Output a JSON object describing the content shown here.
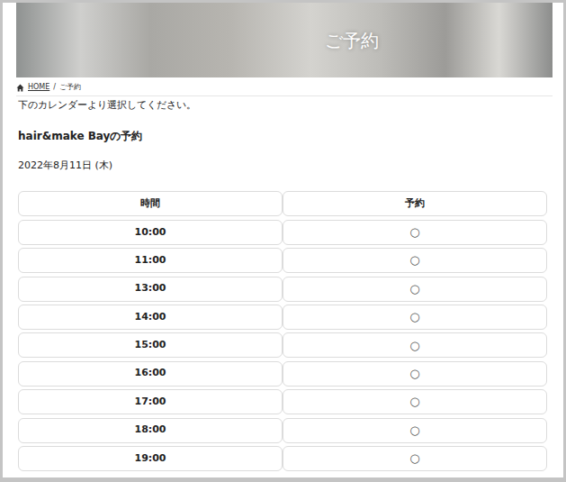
{
  "page_title": "ご予約",
  "breadcrumb": {
    "items": [
      "HOME",
      "ご予約"
    ],
    "separator": "/"
  },
  "intro": "下のカレンダーより選択してください。",
  "heading": "hair&make Bayの予約",
  "date": "2022年8月11日 (木)",
  "table": {
    "columns": [
      "時間",
      "予約"
    ],
    "rows": [
      [
        "10:00",
        "○"
      ],
      [
        "11:00",
        "○"
      ],
      [
        "13:00",
        "○"
      ],
      [
        "14:00",
        "○"
      ],
      [
        "15:00",
        "○"
      ],
      [
        "16:00",
        "○"
      ],
      [
        "17:00",
        "○"
      ],
      [
        "18:00",
        "○"
      ],
      [
        "19:00",
        "○"
      ]
    ]
  }
}
